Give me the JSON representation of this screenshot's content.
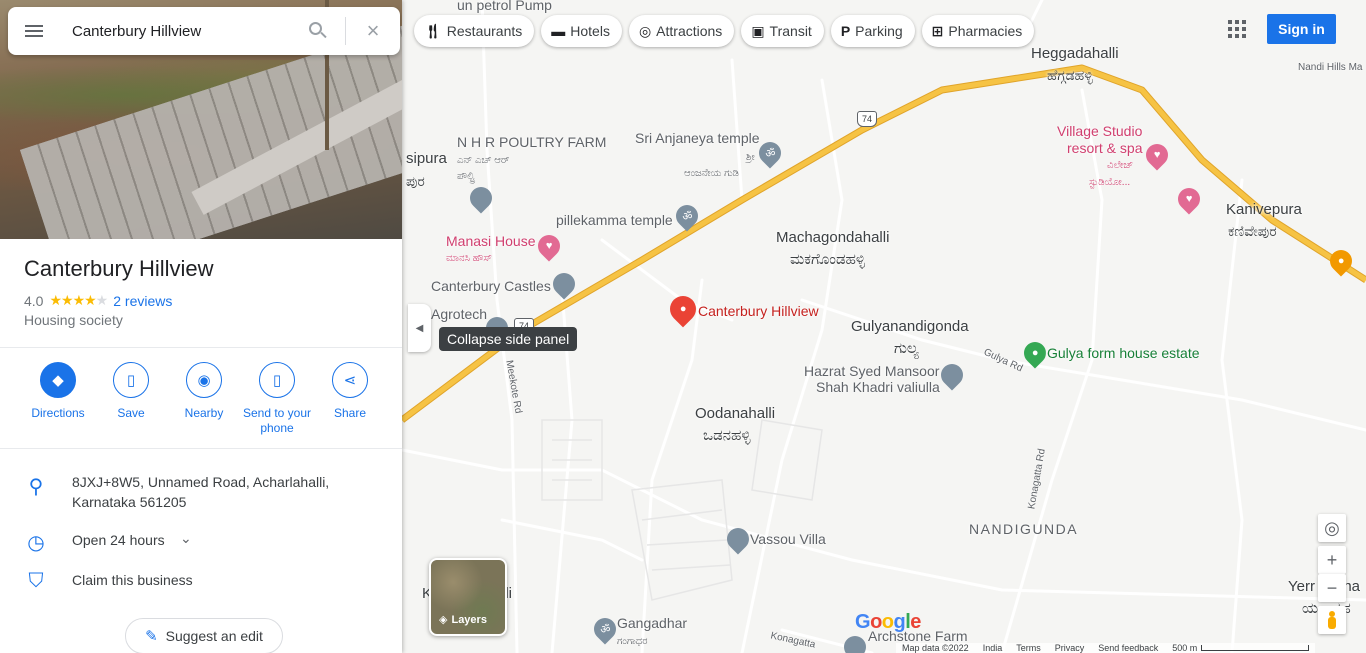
{
  "search": {
    "query": "Canterbury Hillview"
  },
  "place": {
    "title": "Canterbury Hillview",
    "rating": "4.0",
    "stars_filled": 4,
    "reviews": "2 reviews",
    "category": "Housing society",
    "address_line1": "8JXJ+8W5, Unnamed Road, Acharlahalli,",
    "address_line2": "Karnataka 561205",
    "hours": "Open 24 hours",
    "claim": "Claim this business"
  },
  "actions": {
    "directions": "Directions",
    "save": "Save",
    "nearby": "Nearby",
    "send_line1": "Send to your",
    "send_line2": "phone",
    "share": "Share"
  },
  "suggest_edit": "Suggest an edit",
  "tooltip": "Collapse side panel",
  "chips": {
    "restaurants": "Restaurants",
    "hotels": "Hotels",
    "attractions": "Attractions",
    "transit": "Transit",
    "parking": "Parking",
    "pharmacies": "Pharmacies"
  },
  "sign_in": "Sign in",
  "layers": "Layers",
  "map_labels": {
    "petrol_pump": "un petrol Pump",
    "heggadahalli": "Heggadahalli",
    "heggadahalli_kn": "ಹೆಗ್ಗಡಹಳ್ಳಿ",
    "nandi_hills": "Nandi Hills Ma",
    "route_74": "74",
    "nhr_poultry": "N H R POULTRY FARM",
    "nhr_poultry_kn1": "ಎನ್ ಎಚ್ ಆರ್",
    "nhr_poultry_kn2": "ಪೌಲ್ಟ್ರಿ",
    "sri_anjaneya": "Sri Anjaneya temple",
    "sri_anjaneya_kn1": "ಶ್ರೀ",
    "sri_anjaneya_kn2": "ಆಂಜನೇಯ ಗುಡಿ",
    "village_studio1": "Village Studio",
    "village_studio2": "resort & spa",
    "village_studio_kn1": "ವಿಲೇಜ್",
    "village_studio_kn2": "ಸ್ಟುಡಿಯೋ...",
    "sipura": "sipura",
    "sipura_kn": "ಪುರ",
    "pillekamma": "pillekamma temple",
    "kanivepura": "Kanivepura",
    "kanivepura_kn": "ಕಣಿವೇಪುರ",
    "machagondahalli": "Machagondahalli",
    "machagondahalli_kn": "ಮಕಗೊಂಡಹಳ್ಳಿ",
    "manasi_house": "Manasi House",
    "manasi_house_kn": "ಮಾನಸಿ ಹೌಸ್",
    "canterbury_castles": "Canterbury Castles",
    "agrotech": "Agrotech",
    "canterbury_hillview": "Canterbury Hillview",
    "gulyanandigonda": "Gulyanandigonda",
    "gulyanandigonda_kn": "ಗುಲ್ಯ",
    "gulya_farm": "Gulya form house estate",
    "gulya_rd": "Gulya Rd",
    "hazrat1": "Hazrat Syed Mansoor",
    "hazrat2": "Shah Khadri valiulla",
    "meekote_rd": "Meekote Rd",
    "oodanahalli": "Oodanahalli",
    "oodanahalli_kn": "ಒಡನಹಳ್ಳಿ",
    "konagatta_rd": "Konagatta Rd",
    "nandigunda": "NANDIGUNDA",
    "vassou_villa": "Vassou Villa",
    "ka_lli": "K",
    "ka_lli2": "lli",
    "gangadhar": "Gangadhar",
    "gangadhar_kn": "ಗಂಗಾಧರ",
    "konagatta_bottom": "Konagatta",
    "archstone": "Archstone Farm",
    "yerr": "Yerr",
    "yerr2": "ana",
    "yerr_kn": "ಯ",
    "yerr_kn2": "ನಹ"
  },
  "footer": {
    "map_data": "Map data ©2022",
    "india": "India",
    "terms": "Terms",
    "privacy": "Privacy",
    "feedback": "Send feedback",
    "scale": "500 m"
  },
  "colors": {
    "accent": "#1a73e8",
    "highway": "#f6c344",
    "pin": "#ea4335"
  }
}
